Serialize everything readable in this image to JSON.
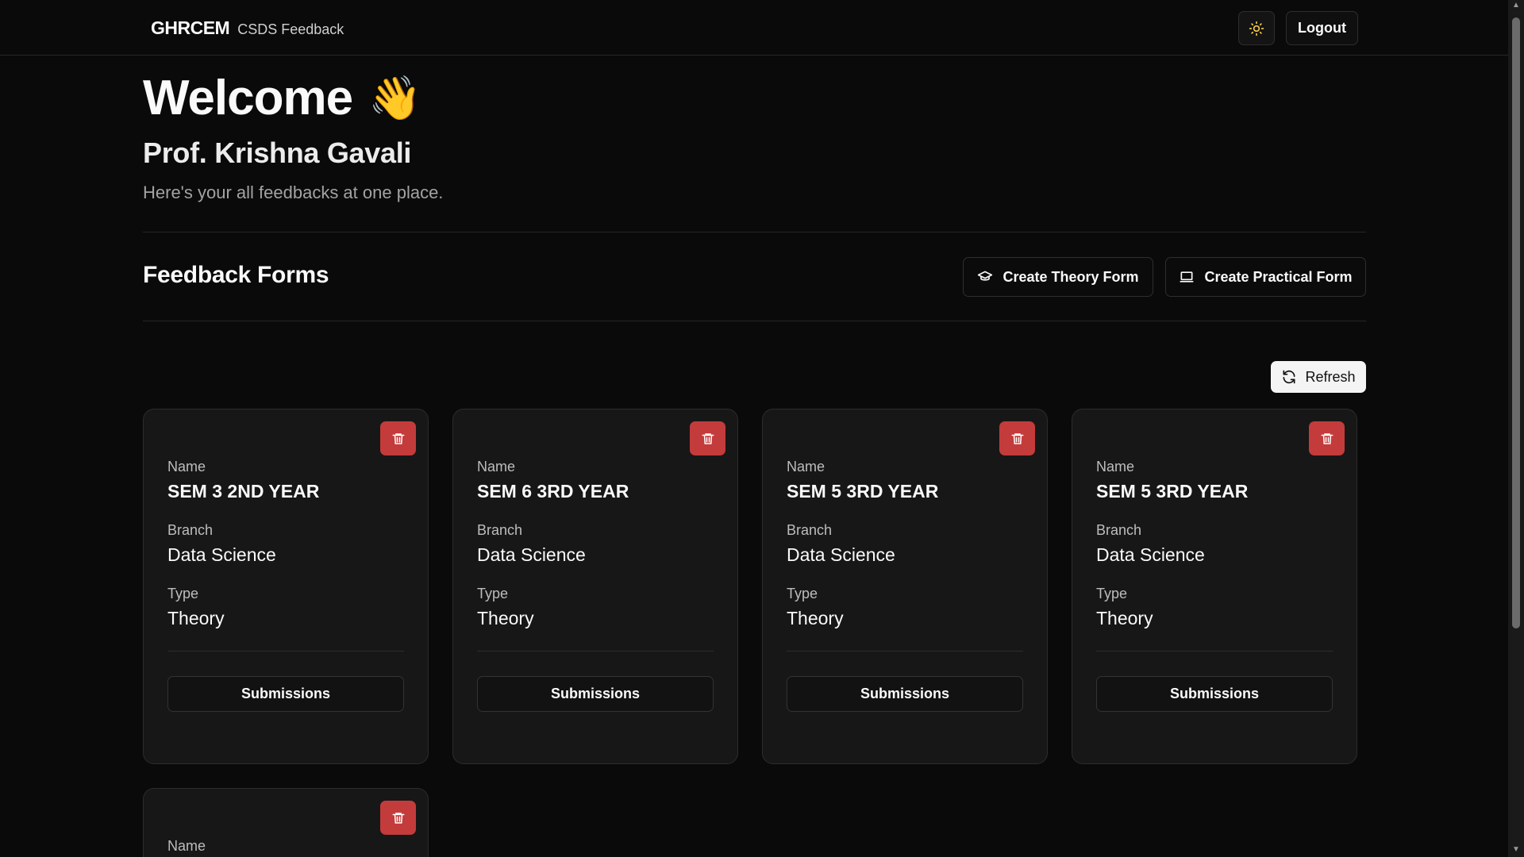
{
  "header": {
    "brand": "GHRCEM",
    "brand_sub": "CSDS Feedback",
    "theme_icon": "sun-icon",
    "logout_label": "Logout"
  },
  "welcome": {
    "title": "Welcome",
    "emoji": "👋",
    "name": "Prof. Krishna Gavali",
    "tagline": "Here's your all feedbacks at one place."
  },
  "forms_section": {
    "title": "Feedback Forms",
    "create_theory_label": "Create Theory Form",
    "create_practical_label": "Create Practical Form",
    "refresh_label": "Refresh"
  },
  "card_labels": {
    "name": "Name",
    "branch": "Branch",
    "type": "Type",
    "submissions": "Submissions"
  },
  "cards": [
    {
      "name": "SEM 3 2ND YEAR",
      "branch": "Data Science",
      "type": "Theory"
    },
    {
      "name": "SEM 6 3RD YEAR",
      "branch": "Data Science",
      "type": "Theory"
    },
    {
      "name": "SEM 5 3RD YEAR",
      "branch": "Data Science",
      "type": "Theory"
    },
    {
      "name": "SEM 5 3RD YEAR",
      "branch": "Data Science",
      "type": "Theory"
    }
  ],
  "colors": {
    "background": "#0a0a0a",
    "card": "#171717",
    "delete": "#c43b3b",
    "refresh_bg": "#f4f4f4"
  }
}
